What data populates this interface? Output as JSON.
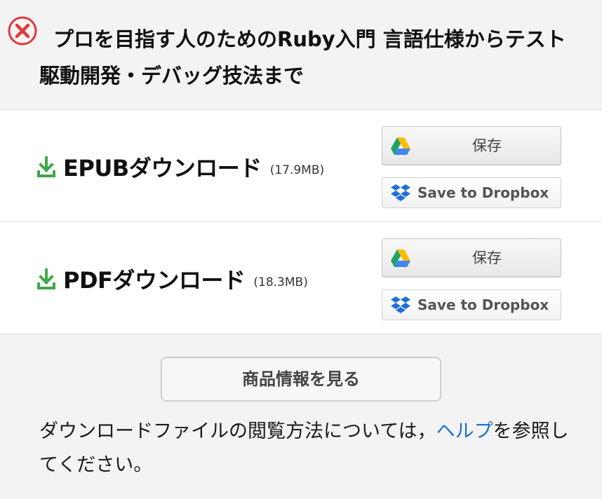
{
  "header": {
    "title": "プロを目指す人のためのRuby入門 言語仕様からテスト駆動開発・デバッグ技法まで"
  },
  "downloads": [
    {
      "label": "EPUBダウンロード",
      "size": "(17.9MB)",
      "gdrive_label": "保存",
      "dropbox_label": "Save to Dropbox"
    },
    {
      "label": "PDFダウンロード",
      "size": "(18.3MB)",
      "gdrive_label": "保存",
      "dropbox_label": "Save to Dropbox"
    }
  ],
  "product_info_button": "商品情報を見る",
  "help": {
    "text_before": "ダウンロードファイルの閲覧方法については，",
    "link": "ヘルプ",
    "text_after": "を参照してください。"
  },
  "colors": {
    "close_red": "#e0393e",
    "download_green": "#3fa84a",
    "dropbox_blue": "#1f6fd6",
    "link_blue": "#1b73c9"
  },
  "icons": {
    "close": "close-circle-icon",
    "download": "download-arrow-icon",
    "gdrive": "google-drive-icon",
    "dropbox": "dropbox-icon"
  }
}
